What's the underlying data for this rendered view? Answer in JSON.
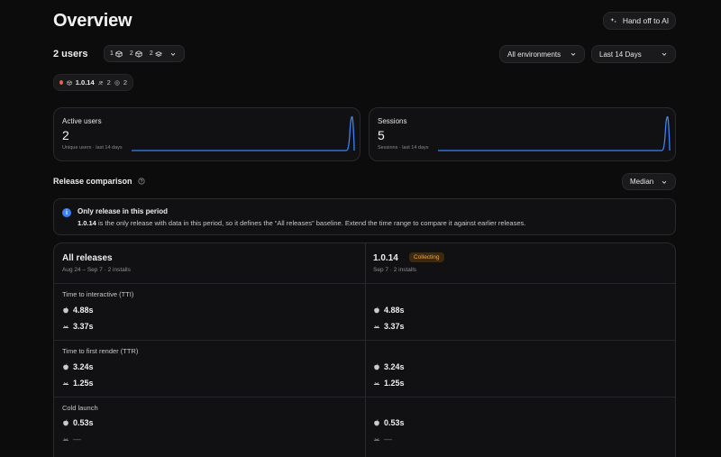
{
  "header": {
    "title": "Overview",
    "handoff_label": "Hand off to AI"
  },
  "users": {
    "title": "2 users",
    "chips": [
      {
        "count": "1",
        "icon": "box-icon"
      },
      {
        "count": "2",
        "icon": "box-icon"
      },
      {
        "count": "2",
        "icon": "stack-icon"
      }
    ]
  },
  "filters": {
    "environment": "All environments",
    "range": "Last 14 Days"
  },
  "release_pill": {
    "version": "1.0.14",
    "users": "2",
    "installs": "2",
    "dot_color": "#e5604a"
  },
  "cards": [
    {
      "label": "Active users",
      "value": "2",
      "sub": "Unique users · last 14 days"
    },
    {
      "label": "Sessions",
      "value": "5",
      "sub": "Sessions · last 14 days"
    }
  ],
  "comparison": {
    "title": "Release comparison",
    "aggregate": "Median"
  },
  "info": {
    "title": "Only release in this period",
    "version": "1.0.14",
    "body": " is the only release with data in this period, so it defines the “All releases” baseline. Extend the time range to compare it against earlier releases."
  },
  "table": {
    "left": {
      "title": "All releases",
      "sub": "Aug 24 – Sep 7 · 2 installs"
    },
    "right": {
      "title": "1.0.14",
      "badge": "Collecting",
      "sub": "Sep 7 · 2 installs"
    },
    "metrics": [
      {
        "name": "Time to interactive (TTI)",
        "left": {
          "ios": "4.88s",
          "android": "3.37s"
        },
        "right": {
          "ios": "4.88s",
          "android": "3.37s"
        }
      },
      {
        "name": "Time to first render (TTR)",
        "left": {
          "ios": "3.24s",
          "android": "1.25s"
        },
        "right": {
          "ios": "3.24s",
          "android": "1.25s"
        }
      },
      {
        "name": "Cold launch",
        "left": {
          "ios": "0.53s",
          "android": "—"
        },
        "right": {
          "ios": "0.53s",
          "android": "—"
        }
      }
    ]
  },
  "colors": {
    "accent": "#3b82f6",
    "badge_text": "#f0a546",
    "badge_bg": "#3a2a12"
  }
}
